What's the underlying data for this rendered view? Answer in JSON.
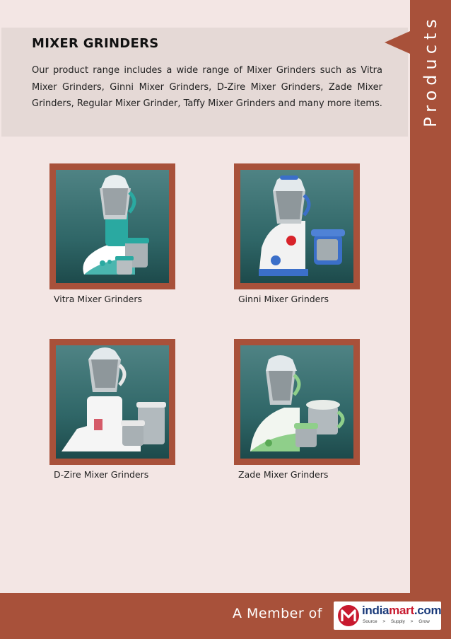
{
  "sidebar": {
    "label": "Products"
  },
  "intro": {
    "title": "MIXER GRINDERS",
    "body": "Our product range includes a wide range of Mixer Grinders such as Vitra Mixer Grinders, Ginni Mixer Grinders, D-Zire Mixer Grinders, Zade Mixer Grinders, Regular Mixer Grinder, Taffy Mixer Grinders and many more items."
  },
  "products": [
    {
      "name": "Vitra Mixer Grinders",
      "accent": "#2aa9a1"
    },
    {
      "name": "Ginni Mixer Grinders",
      "accent": "#3b6fc9"
    },
    {
      "name": "D-Zire Mixer Grinders",
      "accent": "#e8e8e8"
    },
    {
      "name": "Zade Mixer Grinders",
      "accent": "#8fcf8a"
    }
  ],
  "footer": {
    "member_text": "A Member of",
    "logo_main": "india",
    "logo_accent": "mart",
    "logo_suffix": ".com",
    "logo_tagline": "Source > Supply > Grow"
  },
  "colors": {
    "brand": "#a8513a",
    "panel": "#e5d9d6",
    "page": "#f3e6e4"
  }
}
